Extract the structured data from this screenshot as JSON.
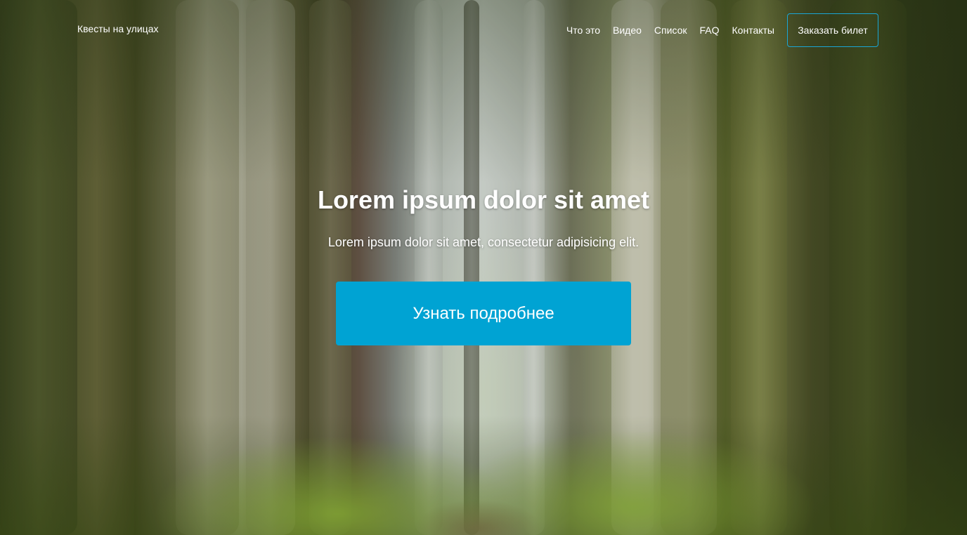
{
  "navbar": {
    "brand": "Квесты на улицах",
    "links": [
      {
        "label": "Что это"
      },
      {
        "label": "Видео"
      },
      {
        "label": "Список"
      },
      {
        "label": "FAQ"
      },
      {
        "label": "Контакты"
      }
    ],
    "order_button": "Заказать билет"
  },
  "hero": {
    "title": "Lorem ipsum dolor sit amet",
    "subtitle": "Lorem ipsum dolor sit amet, consectetur adipisicing elit.",
    "cta_label": "Узнать подробнее"
  },
  "colors": {
    "accent": "#00a3d3",
    "order_button_border": "#1aa6d6",
    "text": "#ffffff"
  },
  "background": {
    "icon": "forest-photo"
  }
}
